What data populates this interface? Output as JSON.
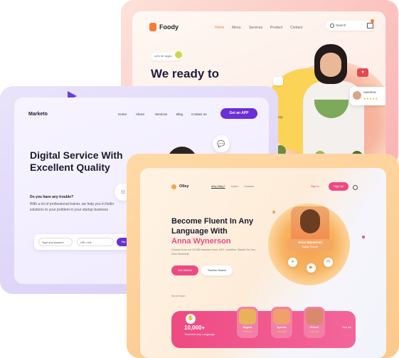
{
  "foody": {
    "brand": "Foody",
    "nav": [
      "Home",
      "Menu",
      "Services",
      "Product",
      "Contact"
    ],
    "search_placeholder": "Search",
    "pill": "Let's be vegan",
    "title": "We ready to",
    "review_name": "ANDREW",
    "review_stars": "★★★★★",
    "category": "delivery",
    "heart": "♥"
  },
  "marketo": {
    "brand": "Marketo",
    "nav": [
      "Home",
      "About",
      "Services",
      "Blog",
      "Contact us"
    ],
    "cta": "Get an APP",
    "headline": "Digital Service With Excellent Quality",
    "question": "Do you have any trouble?",
    "body": "With a lot of professional trainer, we help you in finding solutions to your problem in your startup business",
    "select1": "Type any keyword",
    "select2": "URL Link",
    "go": "Go"
  },
  "olley": {
    "brand": "Olley",
    "nav": [
      "Why Olley?",
      "Learn",
      "Courses"
    ],
    "sign_in": "Sign in",
    "sign_up": "Sign Up",
    "headline_1": "Become Fluent In Any Language With",
    "headline_accent": "Anna Wynerson",
    "subtitle": "Choose from our 10,000 teachers from 100+ countries. Based On You Own Schedule",
    "btn_primary": "Get Started",
    "btn_secondary": "Teacher Search",
    "scroll": "Scroll down",
    "tutor_name": "Anna Wynerson",
    "tutor_role": "English Teacher",
    "count": "10,000+",
    "count_label": "Teachers Any Language",
    "teachers": [
      "English",
      "Spanish",
      "French"
    ],
    "stars": "★★★★★",
    "more": "See All"
  }
}
